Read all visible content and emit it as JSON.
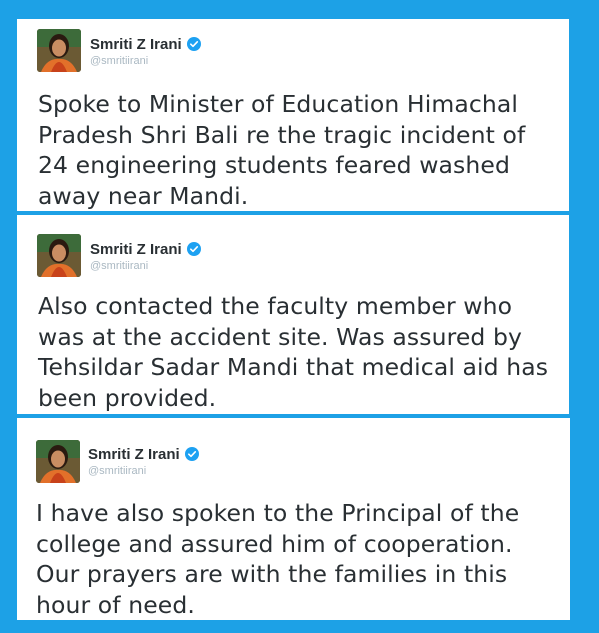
{
  "tweets": [
    {
      "author_name": "Smriti Z Irani",
      "author_handle": "@smritiirani",
      "text": "Spoke to Minister of Education Himachal Pradesh Shri Bali re the tragic incident of 24 engineering students feared washed away near Mandi."
    },
    {
      "author_name": "Smriti Z Irani",
      "author_handle": "@smritiirani",
      "text": "Also contacted the faculty member who was at the accident site. Was assured by Tehsildar Sadar Mandi that medical aid has been provided."
    },
    {
      "author_name": "Smriti Z Irani",
      "author_handle": "@smritiirani",
      "text": "I have also spoken to the Principal of the college and assured him of cooperation. Our prayers are with the families in this hour of need."
    }
  ],
  "colors": {
    "background": "#1da1e6",
    "verified_badge": "#1da1f2",
    "name": "#292f33",
    "handle": "#aab8c2"
  },
  "icons": {
    "verified": "verified-badge-icon"
  }
}
